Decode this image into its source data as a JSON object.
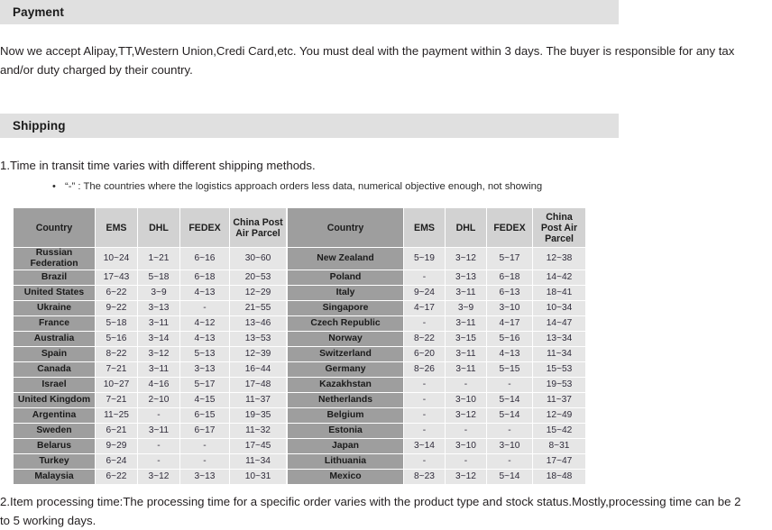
{
  "payment": {
    "heading": "Payment",
    "body": "Now we accept Alipay,TT,Western Union,Credi Card,etc. You must deal with the payment within 3 days. The buyer is responsible for any tax and/or duty charged by their country."
  },
  "shipping": {
    "heading": "Shipping",
    "transit_note": "1.Time in transit time varies with different shipping methods.",
    "bullet_marker": "•",
    "bullet_note": "“-” : The countries where the logistics approach orders less data, numerical objective enough, not showing",
    "processing_note": "2.Item processing time:The processing time for a specific order varies with the product type and stock status.Mostly,processing time can be 2 to 5 working days.",
    "columns": [
      "Country",
      "EMS",
      "DHL",
      "FEDEX",
      "China Post Air Parcel"
    ],
    "table_left": [
      {
        "country": "Russian Federation",
        "ems": "10~24",
        "dhl": "1~21",
        "fedex": "6~16",
        "cpap": "30~60"
      },
      {
        "country": "Brazil",
        "ems": "17~43",
        "dhl": "5~18",
        "fedex": "6~18",
        "cpap": "20~53"
      },
      {
        "country": "United States",
        "ems": "6~22",
        "dhl": "3~9",
        "fedex": "4~13",
        "cpap": "12~29"
      },
      {
        "country": "Ukraine",
        "ems": "9~22",
        "dhl": "3~13",
        "fedex": "-",
        "cpap": "21~55"
      },
      {
        "country": "France",
        "ems": "5~18",
        "dhl": "3~11",
        "fedex": "4~12",
        "cpap": "13~46"
      },
      {
        "country": "Australia",
        "ems": "5~16",
        "dhl": "3~14",
        "fedex": "4~13",
        "cpap": "13~53"
      },
      {
        "country": "Spain",
        "ems": "8~22",
        "dhl": "3~12",
        "fedex": "5~13",
        "cpap": "12~39"
      },
      {
        "country": "Canada",
        "ems": "7~21",
        "dhl": "3~11",
        "fedex": "3~13",
        "cpap": "16~44"
      },
      {
        "country": "Israel",
        "ems": "10~27",
        "dhl": "4~16",
        "fedex": "5~17",
        "cpap": "17~48"
      },
      {
        "country": "United Kingdom",
        "ems": "7~21",
        "dhl": "2~10",
        "fedex": "4~15",
        "cpap": "11~37"
      },
      {
        "country": "Argentina",
        "ems": "11~25",
        "dhl": "-",
        "fedex": "6~15",
        "cpap": "19~35"
      },
      {
        "country": "Sweden",
        "ems": "6~21",
        "dhl": "3~11",
        "fedex": "6~17",
        "cpap": "11~32"
      },
      {
        "country": "Belarus",
        "ems": "9~29",
        "dhl": "-",
        "fedex": "-",
        "cpap": "17~45"
      },
      {
        "country": "Turkey",
        "ems": "6~24",
        "dhl": "-",
        "fedex": "-",
        "cpap": "11~34"
      },
      {
        "country": "Malaysia",
        "ems": "6~22",
        "dhl": "3~12",
        "fedex": "3~13",
        "cpap": "10~31"
      }
    ],
    "table_right": [
      {
        "country": "New Zealand",
        "ems": "5~19",
        "dhl": "3~12",
        "fedex": "5~17",
        "cpap": "12~38"
      },
      {
        "country": "Poland",
        "ems": "-",
        "dhl": "3~13",
        "fedex": "6~18",
        "cpap": "14~42"
      },
      {
        "country": "Italy",
        "ems": "9~24",
        "dhl": "3~11",
        "fedex": "6~13",
        "cpap": "18~41"
      },
      {
        "country": "Singapore",
        "ems": "4~17",
        "dhl": "3~9",
        "fedex": "3~10",
        "cpap": "10~34"
      },
      {
        "country": "Czech Republic",
        "ems": "-",
        "dhl": "3~11",
        "fedex": "4~17",
        "cpap": "14~47"
      },
      {
        "country": "Norway",
        "ems": "8~22",
        "dhl": "3~15",
        "fedex": "5~16",
        "cpap": "13~34"
      },
      {
        "country": "Switzerland",
        "ems": "6~20",
        "dhl": "3~11",
        "fedex": "4~13",
        "cpap": "11~34"
      },
      {
        "country": "Germany",
        "ems": "8~26",
        "dhl": "3~11",
        "fedex": "5~15",
        "cpap": "15~53"
      },
      {
        "country": "Kazakhstan",
        "ems": "-",
        "dhl": "-",
        "fedex": "-",
        "cpap": "19~53"
      },
      {
        "country": "Netherlands",
        "ems": "-",
        "dhl": "3~10",
        "fedex": "5~14",
        "cpap": "11~37"
      },
      {
        "country": "Belgium",
        "ems": "-",
        "dhl": "3~12",
        "fedex": "5~14",
        "cpap": "12~49"
      },
      {
        "country": "Estonia",
        "ems": "-",
        "dhl": "-",
        "fedex": "-",
        "cpap": "15~42"
      },
      {
        "country": "Japan",
        "ems": "3~14",
        "dhl": "3~10",
        "fedex": "3~10",
        "cpap": "8~31"
      },
      {
        "country": "Lithuania",
        "ems": "-",
        "dhl": "-",
        "fedex": "-",
        "cpap": "17~47"
      },
      {
        "country": "Mexico",
        "ems": "8~23",
        "dhl": "3~12",
        "fedex": "5~14",
        "cpap": "18~48"
      }
    ]
  },
  "colors": {
    "section_bar": "#e0e0e0",
    "country_cell": "#9e9e9e",
    "header_cell": "#d2d2d2",
    "value_cell": "#e6e6e6",
    "text": "#231f20"
  }
}
